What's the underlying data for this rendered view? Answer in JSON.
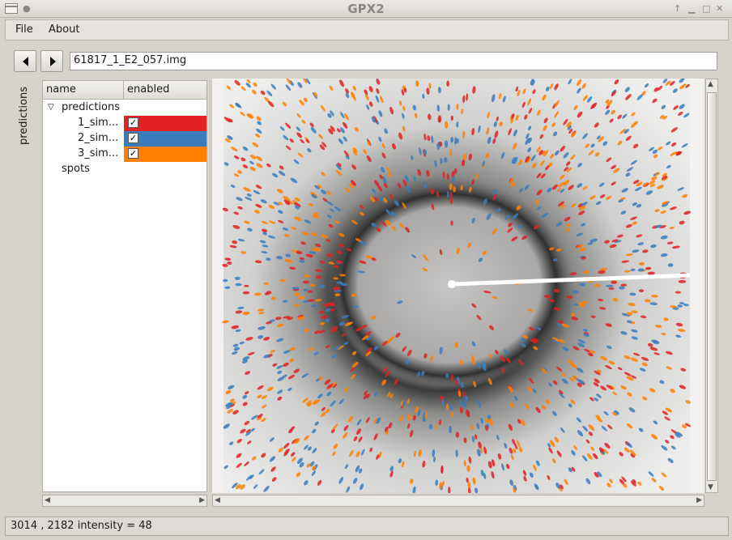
{
  "window": {
    "title": "GPX2"
  },
  "menu": {
    "items": [
      "File",
      "About"
    ]
  },
  "nav": {
    "path": "61817_1_E2_057.img"
  },
  "sidebar": {
    "tab_label": "predictions"
  },
  "tree": {
    "columns": [
      "name",
      "enabled"
    ],
    "rows": [
      {
        "label": "predictions",
        "expandable": true
      },
      {
        "label": "1_sim...",
        "enabled": true,
        "color": "#e02222"
      },
      {
        "label": "2_sim...",
        "enabled": true,
        "color": "#3a7dbd"
      },
      {
        "label": "3_sim...",
        "enabled": true,
        "color": "#ff8000"
      },
      {
        "label": "spots"
      }
    ]
  },
  "status": {
    "text": "3014 , 2182  intensity = 48"
  }
}
